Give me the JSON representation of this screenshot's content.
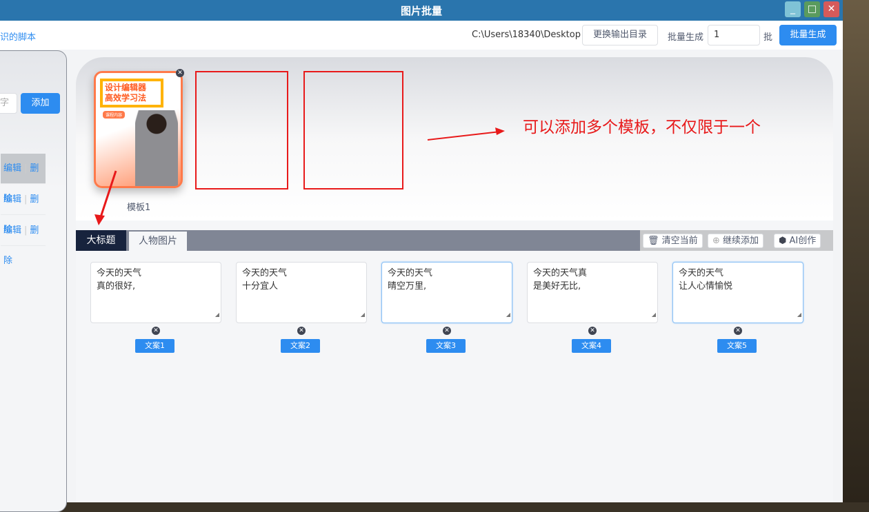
{
  "window": {
    "title": "图片批量",
    "min": "_",
    "max": "□",
    "close": "✕"
  },
  "toolbar": {
    "script_link": "识的脚本",
    "output_path": "C:\\Users\\18340\\Desktop",
    "change_dir": "更换输出目录",
    "batch_label": "批量生成",
    "batch_count": "1",
    "batch_unit": "批",
    "generate": "批量生成"
  },
  "left": {
    "search_placeholder": "字",
    "add": "添加",
    "rows": [
      {
        "edit": "编辑",
        "delete": "删除"
      },
      {
        "edit": "编辑",
        "delete": "删除"
      },
      {
        "edit": "编辑",
        "delete": "删除"
      }
    ]
  },
  "templates": {
    "items": [
      {
        "name": "模板1",
        "poster_title": "设计编辑器\n高效学习法",
        "poster_tag": "课程内容"
      }
    ],
    "annotation": "可以添加多个模板，不仅限于一个"
  },
  "tabs": [
    {
      "label": "大标题",
      "active": true
    },
    {
      "label": "人物图片",
      "active": false
    }
  ],
  "actions": {
    "clear": "清空当前",
    "add_more": "继续添加",
    "ai": "AI创作"
  },
  "texts": [
    {
      "value": "今天的天气\n真的很好,",
      "label": "文案1"
    },
    {
      "value": "今天的天气\n十分宜人",
      "label": "文案2"
    },
    {
      "value": "今天的天气\n晴空万里,",
      "label": "文案3"
    },
    {
      "value": "今天的天气真\n是美好无比,",
      "label": "文案4"
    },
    {
      "value": "今天的天气\n让人心情愉悦",
      "label": "文案5"
    }
  ],
  "colors": {
    "titlebar": "#2a75ad",
    "primary": "#2d8cf0",
    "annotation": "#e8191a",
    "tab_active": "#17233d"
  }
}
